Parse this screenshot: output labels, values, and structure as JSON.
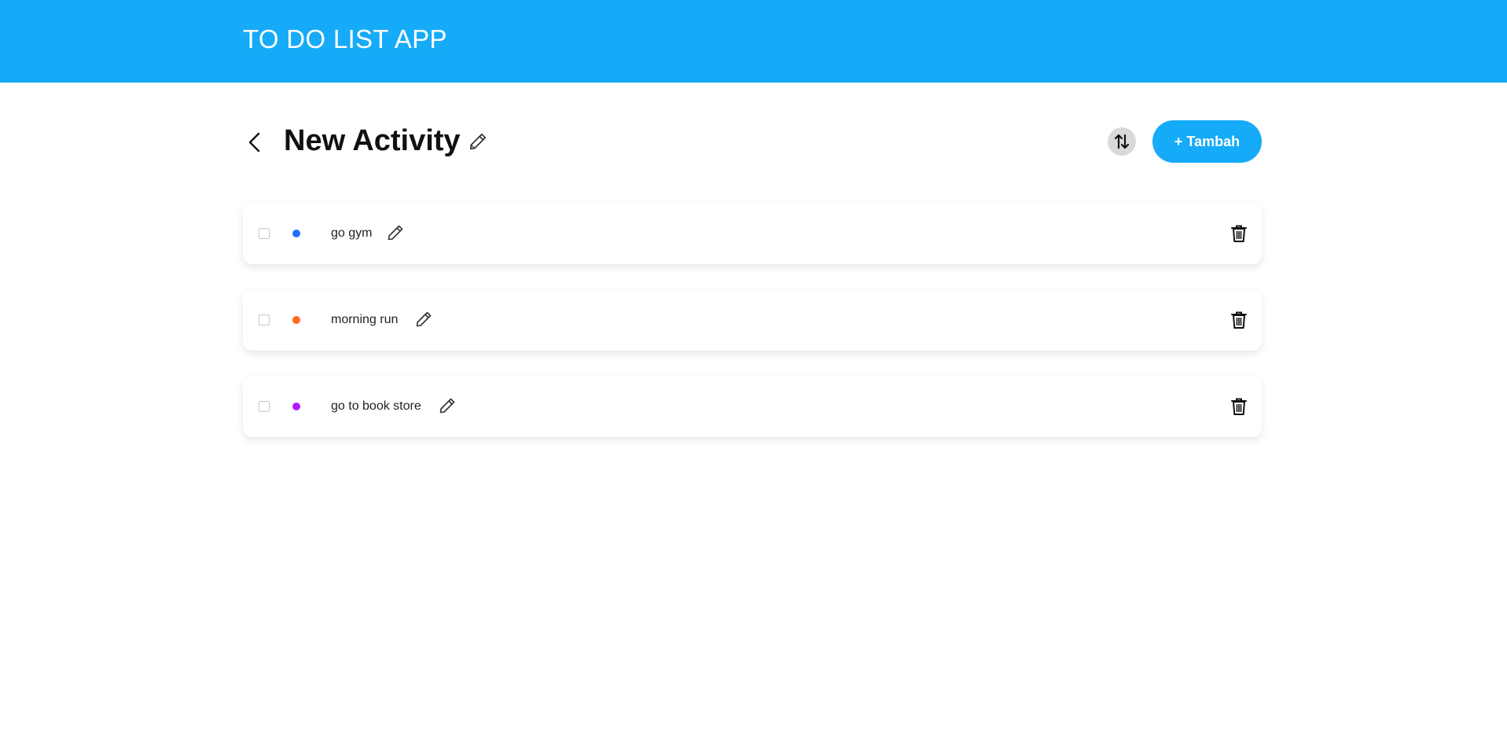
{
  "header": {
    "title": "TO DO LIST APP",
    "background_color": "#16abf8"
  },
  "activity": {
    "title": "New Activity",
    "back_icon": "chevron-left-icon",
    "edit_icon": "pencil-icon"
  },
  "toolbar": {
    "sort_icon": "sort-arrows-icon",
    "add_label": "+ Tambah",
    "add_color": "#16abf8"
  },
  "todos": [
    {
      "title": "go gym",
      "priority_color": "#1e6fff",
      "checked": false
    },
    {
      "title": "morning run",
      "priority_color": "#ff6a1a",
      "checked": false
    },
    {
      "title": "go to book store",
      "priority_color": "#b01aff",
      "checked": false
    }
  ]
}
